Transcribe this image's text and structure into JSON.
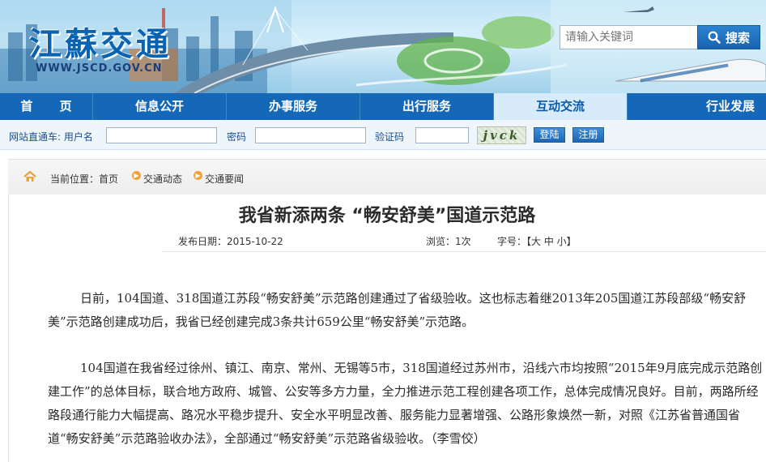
{
  "header": {
    "logo_text": "江蘇交通",
    "logo_url": "WWW.JSCD.GOV.CN",
    "search_placeholder": "请输入关键词",
    "search_button": "搜索"
  },
  "nav": {
    "items": [
      {
        "label": "首 页"
      },
      {
        "label": "信息公开"
      },
      {
        "label": "办事服务"
      },
      {
        "label": "出行服务"
      },
      {
        "label": "互动交流"
      },
      {
        "label": "行业发展"
      }
    ]
  },
  "login": {
    "direct_label": "网站直通车: 用户名",
    "password_label": "密码",
    "captcha_label": "验证码",
    "captcha_text": "jvck",
    "login_button": "登陆",
    "register_button": "注册"
  },
  "breadcrumb": {
    "prefix": "当前位置：首页",
    "level1": "交通动态",
    "level2": "交通要闻"
  },
  "article": {
    "title": "我省新添两条 “畅安舒美”国道示范路",
    "publish_date": "发布日期：2015-10-22",
    "views": "浏览：1次",
    "font_size_label": "字号：【大  中  小】",
    "paragraphs": [
      "日前，104国道、318国道江苏段“畅安舒美”示范路创建通过了省级验收。这也标志着继2013年205国道江苏段部级“畅安舒美”示范路创建成功后，我省已经创建完成3条共计659公里“畅安舒美”示范路。",
      "104国道在我省经过徐州、镇江、南京、常州、无锡等5市，318国道经过苏州市，沿线六市均按照“2015年9月底完成示范路创建工作”的总体目标，联合地方政府、城管、公安等多方力量，全力推进示范工程创建各项工作，总体完成情况良好。目前，两路所经路段通行能力大幅提高、路况水平稳步提升、安全水平明显改善、服务能力显著增强、公路形象焕然一新，对照《江苏省普通国省道“畅安舒美”示范路验收办法》，全部通过“畅安舒美”示范路省级验收。（李雪佼）"
    ]
  },
  "colors": {
    "nav_bg": "#1468b7",
    "nav_active_bg": "#d8ebfa",
    "login_bar_bg": "#eef5fb",
    "accent_orange": "#f0a23a"
  }
}
